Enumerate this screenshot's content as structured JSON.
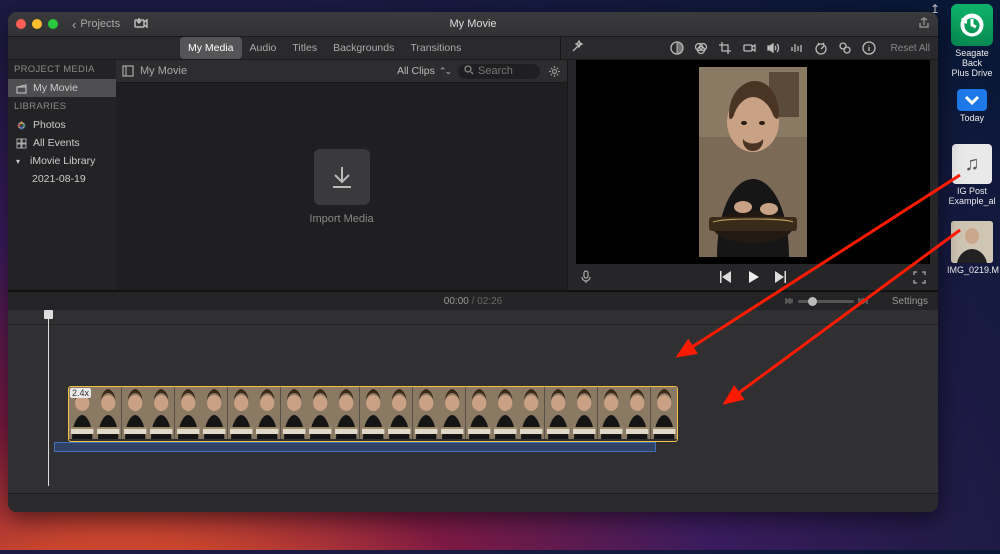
{
  "menubar": {
    "share_glyph": "↥"
  },
  "desktop": {
    "drive_name": "Seagate Back\nPlus Drive",
    "today_label": "Today",
    "file1": "IG Post\nExample_al",
    "file2": "IMG_0219.M"
  },
  "window": {
    "back_label": "Projects",
    "title": "My Movie"
  },
  "tabs": {
    "items": [
      "My Media",
      "Audio",
      "Titles",
      "Backgrounds",
      "Transitions"
    ],
    "active_index": 0
  },
  "viewer_tools": {
    "reset_label": "Reset All"
  },
  "sidebar": {
    "section1": "PROJECT MEDIA",
    "project_item": "My Movie",
    "section2": "LIBRARIES",
    "photos": "Photos",
    "all_events": "All Events",
    "library": "iMovie Library",
    "event": "2021-08-19"
  },
  "browser": {
    "title": "My Movie",
    "filter": "All Clips",
    "search_placeholder": "Search",
    "import_label": "Import Media"
  },
  "playback": {
    "current": "00:00",
    "total": "02:26"
  },
  "timeline": {
    "clip_badge": "2.4x",
    "settings_label": "Settings"
  }
}
